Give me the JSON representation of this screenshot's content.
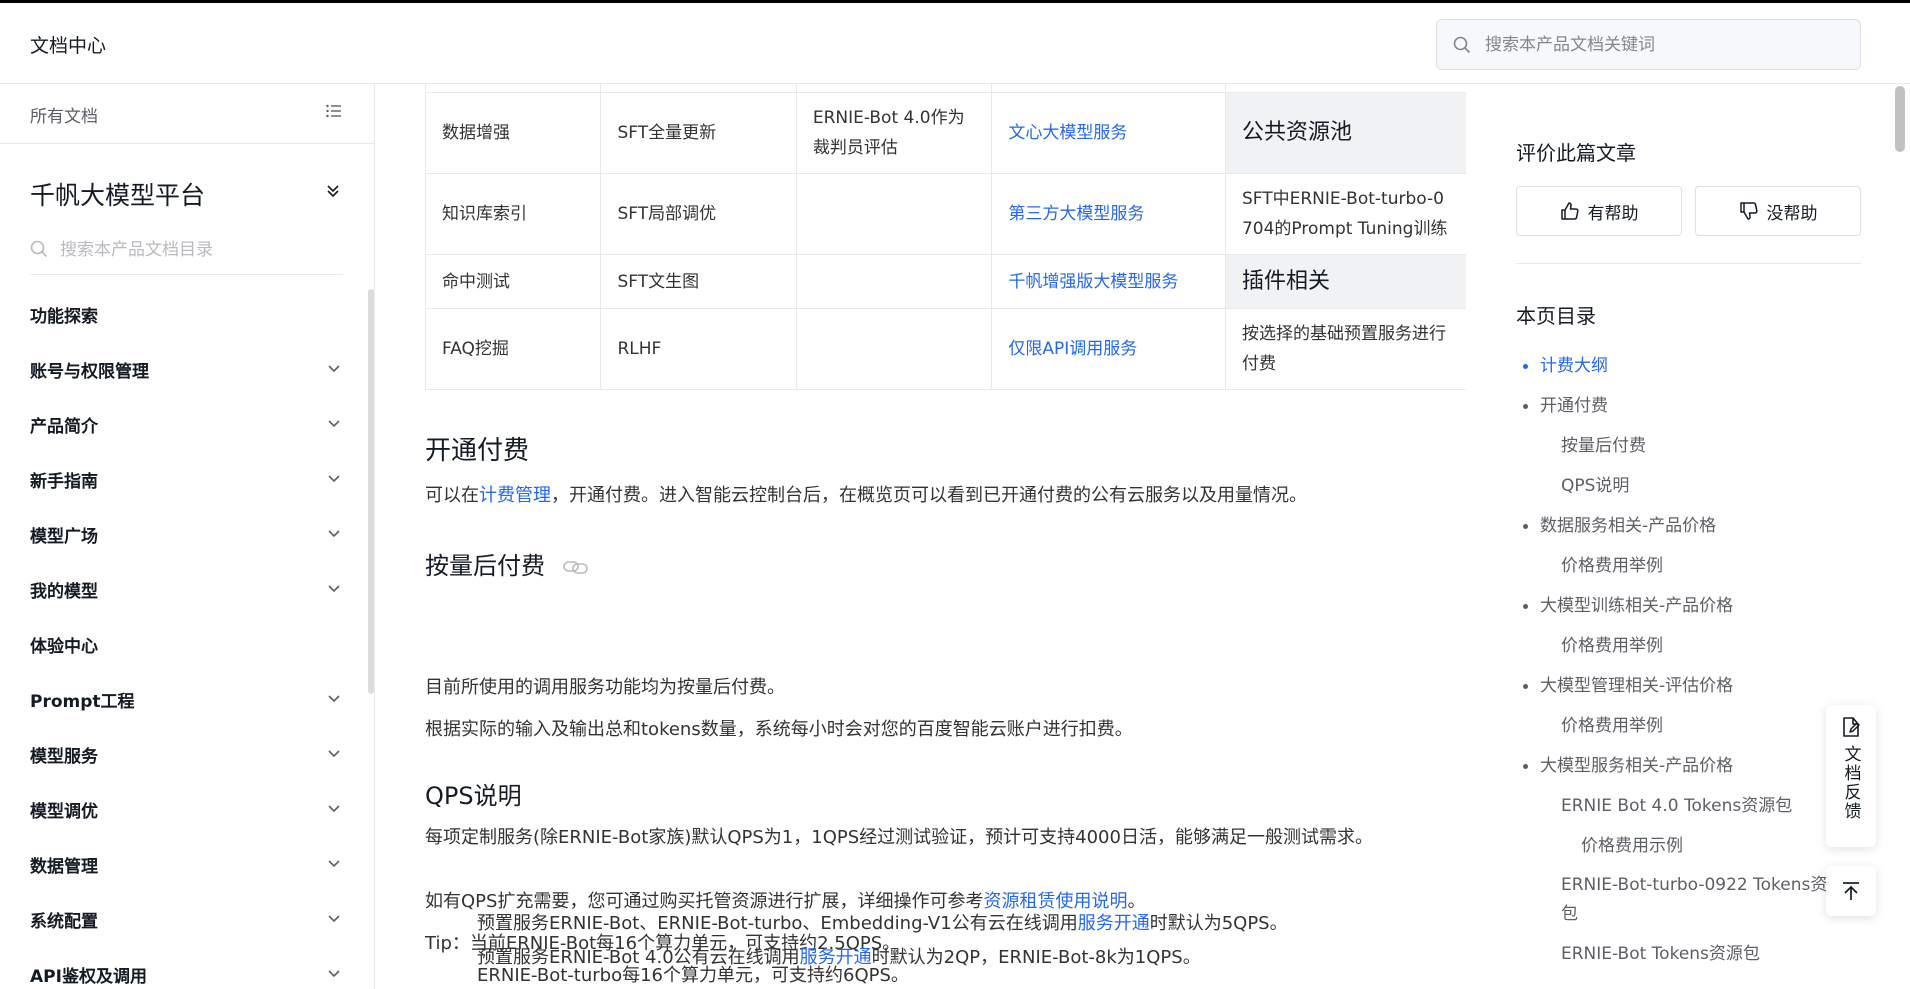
{
  "header": {
    "brand": "文档中心",
    "search_placeholder": "搜索本产品文档关键词"
  },
  "sidebar": {
    "all_docs": "所有文档",
    "platform_title": "千帆大模型平台",
    "search_placeholder": "搜索本产品文档目录",
    "items": [
      {
        "label": "功能探索",
        "expandable": false
      },
      {
        "label": "账号与权限管理",
        "expandable": true
      },
      {
        "label": "产品简介",
        "expandable": true
      },
      {
        "label": "新手指南",
        "expandable": true
      },
      {
        "label": "模型广场",
        "expandable": true
      },
      {
        "label": "我的模型",
        "expandable": true
      },
      {
        "label": "体验中心",
        "expandable": false
      },
      {
        "label": "Prompt工程",
        "expandable": true
      },
      {
        "label": "模型服务",
        "expandable": true
      },
      {
        "label": "模型调优",
        "expandable": true
      },
      {
        "label": "数据管理",
        "expandable": true
      },
      {
        "label": "系统配置",
        "expandable": true
      },
      {
        "label": "API鉴权及调用",
        "expandable": true
      }
    ]
  },
  "table": {
    "rows": [
      [
        "数据增强",
        "SFT全量更新",
        "ERNIE-Bot 4.0作为裁判员评估",
        "文心大模型服务",
        "公共资源池"
      ],
      [
        "知识库索引",
        "SFT局部调优",
        "",
        "第三方大模型服务",
        "SFT中ERNIE-Bot-turbo-0704的Prompt Tuning训练"
      ],
      [
        "命中测试",
        "SFT文生图",
        "",
        "千帆增强版大模型服务",
        "插件相关"
      ],
      [
        "FAQ挖掘",
        "RLHF",
        "",
        "仅限API调用服务",
        "按选择的基础预置服务进行付费"
      ]
    ]
  },
  "content": {
    "activation_title": "开通付费",
    "activation_pre": "可以在",
    "activation_link": "计费管理",
    "activation_post": "，开通付费。进入智能云控制台后，在概览页可以看到已开通付费的公有云服务以及用量情况。",
    "postpaid_title": "按量后付费",
    "postpaid_p1": "目前所使用的调用服务功能均为按量后付费。",
    "postpaid_p2": "根据实际的输入及输出总和tokens数量，系统每小时会对您的百度智能云账户进行扣费。",
    "qps_title": "QPS说明",
    "qps_p1": "每项定制服务(除ERNIE-Bot家族)默认QPS为1，1QPS经过测试验证，预计可支持4000日活，能够满足一般测试需求。",
    "qps_p2_pre": "如有QPS扩充需要，您可通过购买托管资源进行扩展，详细操作可参考",
    "qps_p2_link": "资源租赁使用说明",
    "qps_p2_post": "。",
    "tip_label": "Tip：",
    "tip_1": "当前ERNIE-Bot每16个算力单元，可支持约2.5QPS。",
    "tip_2": "ERNIE-Bot-turbo每16个算力单元，可支持约6QPS。",
    "tip_3_pre": "预置服务ERNIE-Bot、ERNIE-Bot-turbo、Embedding-V1公有云在线调用",
    "tip_3_link": "服务开通",
    "tip_3_post": "时默认为5QPS。",
    "tip_4_pre": "预置服务ERNIE-Bot 4.0公有云在线调用",
    "tip_4_link": "服务开通",
    "tip_4_post": "时默认为2QP，ERNIE-Bot-8k为1QPS。"
  },
  "rating": {
    "title": "评价此篇文章",
    "helpful": "有帮助",
    "not_helpful": "没帮助"
  },
  "toc": {
    "title": "本页目录",
    "items": [
      {
        "label": "计费大纲",
        "level": 1,
        "active": true
      },
      {
        "label": "开通付费",
        "level": 1
      },
      {
        "label": "按量后付费",
        "level": 2
      },
      {
        "label": "QPS说明",
        "level": 2
      },
      {
        "label": "数据服务相关-产品价格",
        "level": 1
      },
      {
        "label": "价格费用举例",
        "level": 2
      },
      {
        "label": "大模型训练相关-产品价格",
        "level": 1
      },
      {
        "label": "价格费用举例",
        "level": 2
      },
      {
        "label": "大模型管理相关-评估价格",
        "level": 1
      },
      {
        "label": "价格费用举例",
        "level": 2
      },
      {
        "label": "大模型服务相关-产品价格",
        "level": 1
      },
      {
        "label": "ERNIE Bot 4.0 Tokens资源包",
        "level": 2
      },
      {
        "label": "价格费用示例",
        "level": 3
      },
      {
        "label": "ERNIE-Bot-turbo-0922 Tokens资源包",
        "level": 2
      },
      {
        "label": "ERNIE-Bot Tokens资源包",
        "level": 2
      }
    ]
  },
  "float": {
    "feedback": "文档反馈"
  },
  "colors": {
    "link": "#2468f2",
    "text": "#151b26",
    "border": "#e8e9eb"
  }
}
